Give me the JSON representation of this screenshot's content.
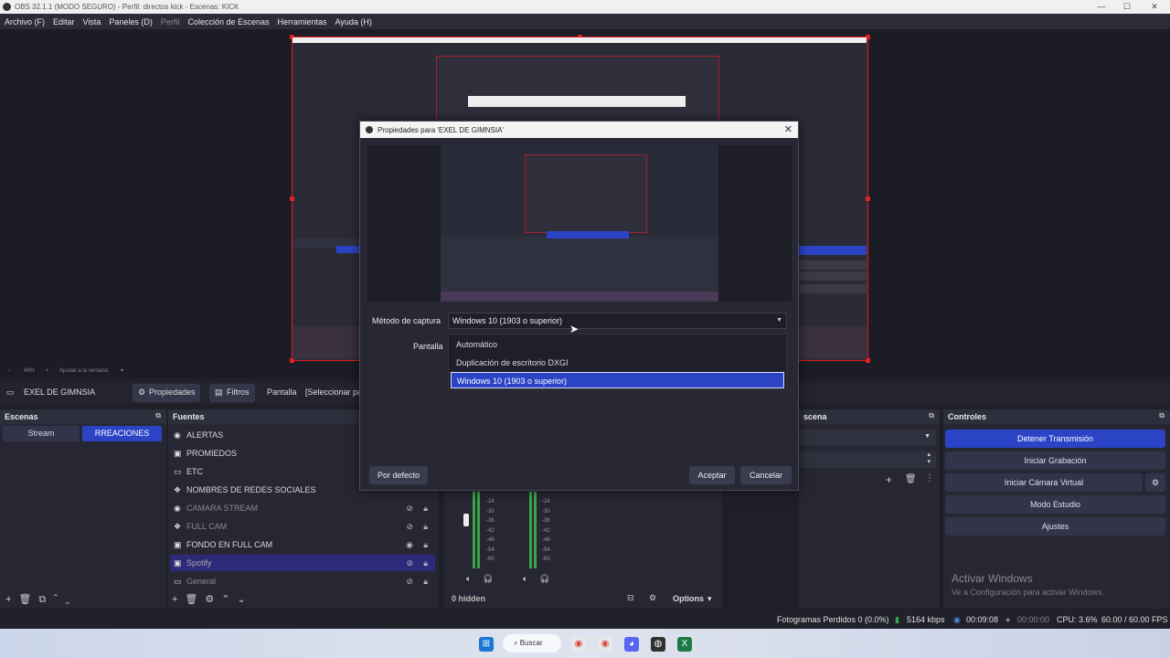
{
  "titlebar": {
    "title": "OBS 32.1.1 (MODO SEGURO) - Perfil: directos kick - Escenas: KICK"
  },
  "menu": [
    "Archivo (F)",
    "Editar",
    "Vista",
    "Paneles (D)",
    "Perfil",
    "Colección de Escenas",
    "Herramientas",
    "Ayuda (H)"
  ],
  "zoom": {
    "level": "49%",
    "fit": "Ajustar a la ventana"
  },
  "toolbar": {
    "source": "EXEL DE GIMNSIA",
    "properties": "Propiedades",
    "filters": "Filtros",
    "display_label": "Pantalla",
    "display_value": "[Seleccionar pa"
  },
  "docks": {
    "scenes": "Escenas",
    "sources": "Fuentes",
    "transitions": "scena",
    "controls": "Controles"
  },
  "scenes": [
    "Stream",
    "RREACIONES"
  ],
  "sources": [
    "ALERTAS",
    "PROMIEDOS",
    "ETC",
    "NOMBRES DE REDES SOCIALES",
    "CAMARA STREAM",
    "FULL CAM",
    "FONDO EN FULL CAM",
    "Spotify",
    "General"
  ],
  "controls": [
    "Detener Transmisión",
    "Iniciar Grabación",
    "Iniciar Cámara Virtual",
    "Modo Estudio",
    "Ajustes"
  ],
  "mixer": {
    "hidden": "0 hidden",
    "options": "Options",
    "ticks": [
      "-24",
      "-30",
      "-36",
      "-42",
      "-48",
      "-54",
      "-60"
    ]
  },
  "activate": {
    "title": "Activar Windows",
    "subtitle": "Ve a Configuración para activar Windows."
  },
  "status": {
    "dropped": "Fotogramas Perdidos 0 (0.0%)",
    "bitrate": "5164 kbps",
    "stream_time": "00:09:08",
    "rec_time": "00:00:00",
    "cpu": "CPU: 3.6%",
    "fps": "60.00 / 60.00 FPS"
  },
  "taskbar": {
    "search": "Buscar"
  },
  "dialog": {
    "title": "Propiedades para 'EXEL DE GIMNSIA'",
    "capture_label": "Método de captura",
    "capture_value": "Windows 10 (1903 o superior)",
    "display_label": "Pantalla",
    "options": [
      "Automático",
      "Duplicación de escritorio DXGI",
      "Windows 10 (1903 o superior)"
    ],
    "defaults": "Por defecto",
    "accept": "Aceptar",
    "cancel": "Cancelar"
  },
  "colors": {
    "accent": "#2b44c6",
    "selection_red": "#e02020",
    "meter_green": "#3aa64a"
  }
}
